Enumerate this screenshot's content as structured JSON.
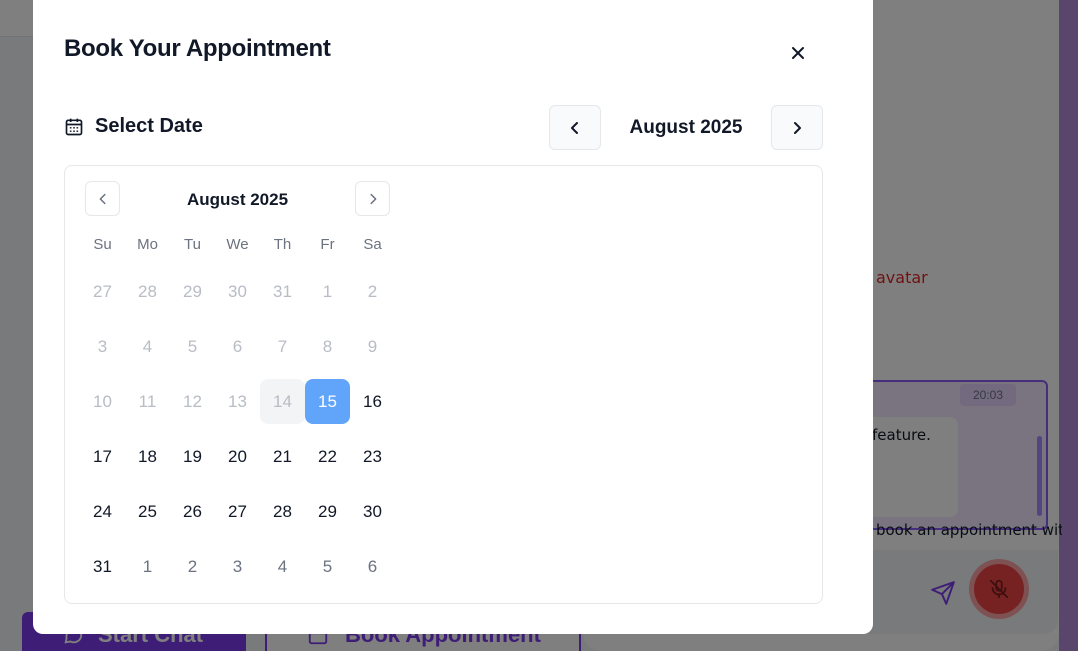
{
  "background": {
    "avatar_text": "avatar",
    "chat_time": "20:03",
    "chat_bubble_text": "feature.",
    "chat_preview": "o book an appointment with",
    "start_chat_label": "Start Chat",
    "book_appointment_label": "Book Appointment"
  },
  "modal": {
    "title": "Book Your Appointment",
    "section_label": "Select Date",
    "header_month": "August 2025"
  },
  "calendar": {
    "caption": "August 2025",
    "weekdays": [
      "Su",
      "Mo",
      "Tu",
      "We",
      "Th",
      "Fr",
      "Sa"
    ],
    "days": [
      {
        "label": "27",
        "state": "outside"
      },
      {
        "label": "28",
        "state": "outside"
      },
      {
        "label": "29",
        "state": "outside"
      },
      {
        "label": "30",
        "state": "outside"
      },
      {
        "label": "31",
        "state": "outside"
      },
      {
        "label": "1",
        "state": "disabled"
      },
      {
        "label": "2",
        "state": "disabled"
      },
      {
        "label": "3",
        "state": "disabled"
      },
      {
        "label": "4",
        "state": "disabled"
      },
      {
        "label": "5",
        "state": "disabled"
      },
      {
        "label": "6",
        "state": "disabled"
      },
      {
        "label": "7",
        "state": "disabled"
      },
      {
        "label": "8",
        "state": "disabled"
      },
      {
        "label": "9",
        "state": "disabled"
      },
      {
        "label": "10",
        "state": "disabled"
      },
      {
        "label": "11",
        "state": "disabled"
      },
      {
        "label": "12",
        "state": "disabled"
      },
      {
        "label": "13",
        "state": "disabled"
      },
      {
        "label": "14",
        "state": "today"
      },
      {
        "label": "15",
        "state": "selected"
      },
      {
        "label": "16",
        "state": "available"
      },
      {
        "label": "17",
        "state": "available"
      },
      {
        "label": "18",
        "state": "available"
      },
      {
        "label": "19",
        "state": "available"
      },
      {
        "label": "20",
        "state": "available"
      },
      {
        "label": "21",
        "state": "available"
      },
      {
        "label": "22",
        "state": "available"
      },
      {
        "label": "23",
        "state": "available"
      },
      {
        "label": "24",
        "state": "available"
      },
      {
        "label": "25",
        "state": "available"
      },
      {
        "label": "26",
        "state": "available"
      },
      {
        "label": "27",
        "state": "available"
      },
      {
        "label": "28",
        "state": "available"
      },
      {
        "label": "29",
        "state": "available"
      },
      {
        "label": "30",
        "state": "available"
      },
      {
        "label": "31",
        "state": "available"
      },
      {
        "label": "1",
        "state": "next-outside"
      },
      {
        "label": "2",
        "state": "next-outside"
      },
      {
        "label": "3",
        "state": "next-outside"
      },
      {
        "label": "4",
        "state": "next-outside"
      },
      {
        "label": "5",
        "state": "next-outside"
      },
      {
        "label": "6",
        "state": "next-outside"
      }
    ]
  },
  "colors": {
    "selected_day": "#60a5fa",
    "brand_purple": "#7c3aed",
    "mic_red": "#ef4444"
  },
  "icons": {
    "close": "close-icon",
    "calendar": "calendar-icon",
    "prev": "chevron-left-icon",
    "next": "chevron-right-icon"
  }
}
